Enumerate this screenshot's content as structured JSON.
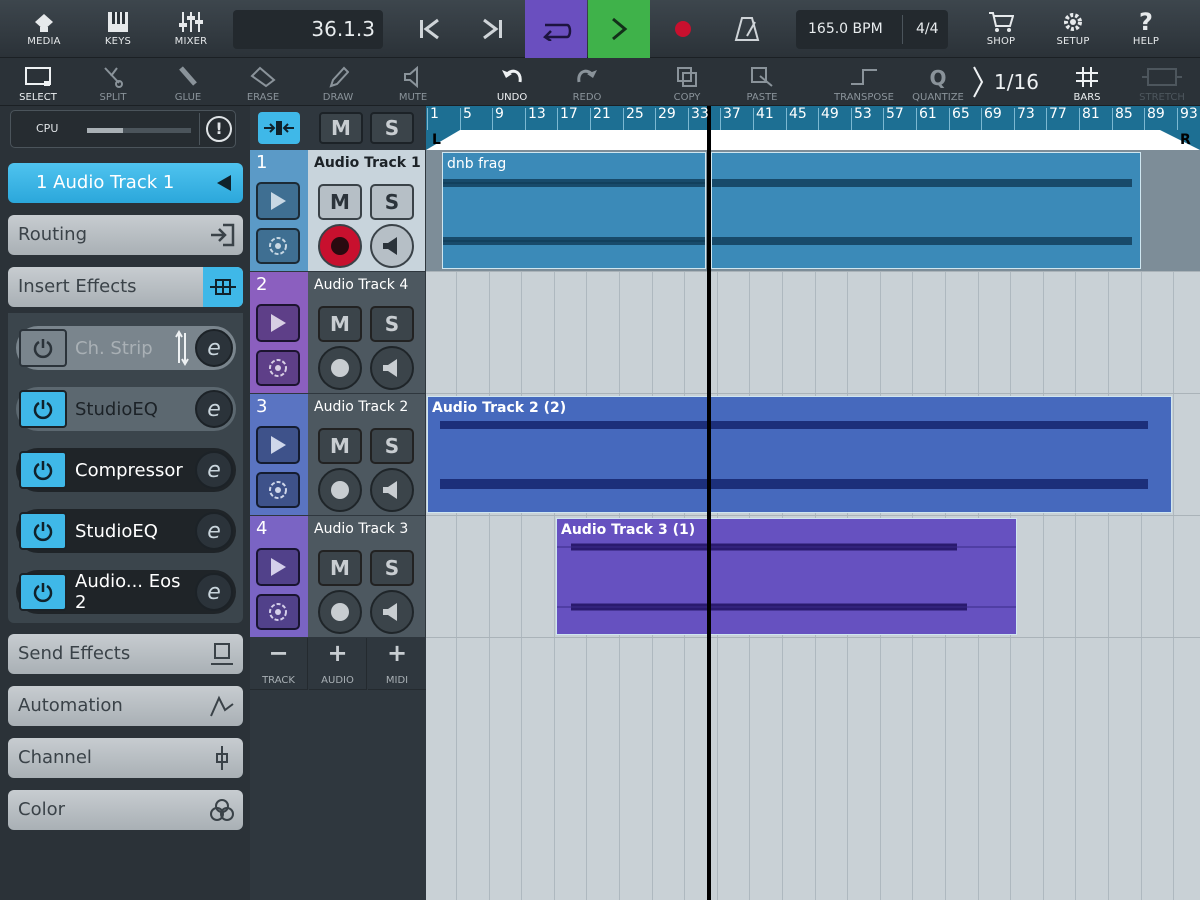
{
  "topbar": {
    "media_label": "MEDIA",
    "keys_label": "KEYS",
    "mixer_label": "MIXER",
    "position": "36.1.3",
    "bpm": "165.0 BPM",
    "time_signature": "4/4",
    "shop_label": "SHOP",
    "setup_label": "SETUP",
    "help_label": "HELP"
  },
  "tools": {
    "select": "SELECT",
    "split": "SPLIT",
    "glue": "GLUE",
    "erase": "ERASE",
    "draw": "DRAW",
    "mute": "MUTE",
    "undo": "UNDO",
    "redo": "REDO",
    "copy": "COPY",
    "paste": "PASTE",
    "transpose": "TRANSPOSE",
    "quantize": "QUANTIZE",
    "quantize_value": "1/16",
    "bars": "BARS",
    "stretch": "STRETCH"
  },
  "left": {
    "cpu_label": "CPU",
    "cpu_level": 0.35,
    "selected_track": "1  Audio Track 1",
    "routing": "Routing",
    "insert_effects": "Insert Effects",
    "effects": [
      {
        "name": "Ch. Strip",
        "enabled": false
      },
      {
        "name": "StudioEQ",
        "enabled": true
      },
      {
        "name": "Compressor",
        "enabled": true
      },
      {
        "name": "StudioEQ",
        "enabled": true
      },
      {
        "name": "Audio... Eos 2",
        "enabled": true
      }
    ],
    "send_effects": "Send Effects",
    "automation": "Automation",
    "channel": "Channel",
    "color": "Color"
  },
  "tracks": [
    {
      "number": "1",
      "name": "Audio Track 1",
      "color": "#5b9ac7",
      "armed": true
    },
    {
      "number": "2",
      "name": "Audio Track 4",
      "color": "#8b5fbf",
      "armed": false
    },
    {
      "number": "3",
      "name": "Audio Track 2",
      "color": "#5a74c2",
      "armed": false
    },
    {
      "number": "4",
      "name": "Audio Track 3",
      "color": "#7a64c4",
      "armed": false
    }
  ],
  "track_add": {
    "remove_track": "TRACK",
    "add_audio": "AUDIO",
    "add_midi": "MIDI"
  },
  "ruler": {
    "bars": [
      "1",
      "5",
      "9",
      "13",
      "17",
      "21",
      "25",
      "29",
      "33",
      "37",
      "41",
      "45",
      "49",
      "53",
      "57",
      "61",
      "65",
      "69",
      "73",
      "77",
      "81",
      "85",
      "89",
      "93"
    ],
    "left_locator": "L",
    "right_locator": "R"
  },
  "clips": [
    {
      "name": "dnb frag",
      "track": 1
    },
    {
      "name": "",
      "track": 1
    },
    {
      "name": "Audio Track 2 (2)",
      "track": 3
    },
    {
      "name": "Audio Track 3 (1)",
      "track": 4
    }
  ],
  "colors": {
    "accent": "#3fb8e8",
    "loop": "#6a4fbf",
    "play": "#3fb24a",
    "record": "#c8102e"
  }
}
